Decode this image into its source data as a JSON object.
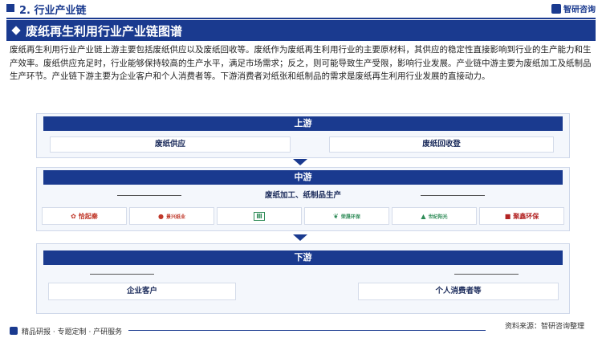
{
  "header": {
    "section": "2. 行业产业链",
    "brand": "智研咨询"
  },
  "title": "废纸再生利用行业产业链图谱",
  "description": "废纸再生利用行业产业链上游主要包括废纸供应以及废纸回收等。废纸作为废纸再生利用行业的主要原材料，其供应的稳定性直接影响到行业的生产能力和生产效率。废纸供应充足时，行业能够保持较高的生产水平，满足市场需求；反之，则可能导致生产受限，影响行业发展。产业链中游主要为废纸加工及纸制品生产环节。产业链下游主要为企业客户和个人消费者等。下游消费者对纸张和纸制品的需求是废纸再生利用行业发展的直接动力。",
  "upstream": {
    "label": "上游",
    "items": [
      "废纸供应",
      "废纸回收登"
    ]
  },
  "midstream": {
    "label": "中游",
    "sub_label": "废纸加工、纸制品生产",
    "logos": [
      {
        "text": "恰起秦",
        "color": "#c0392b",
        "icon": "seal-icon"
      },
      {
        "text": "景兴纸业",
        "color": "#c0392b",
        "icon": "brand-mark-icon"
      },
      {
        "text": "山鹰",
        "color": "#2e8b57",
        "icon": "box-logo-icon"
      },
      {
        "text": "荣晟环保",
        "color": "#2e8b57",
        "icon": "leaf-logo-icon"
      },
      {
        "text": "世纪阳光",
        "color": "#2e8b57",
        "icon": "triangle-logo-icon"
      },
      {
        "text": "聚鑫环保",
        "color": "#b22222",
        "icon": "jx-logo-icon"
      }
    ]
  },
  "downstream": {
    "label": "下游",
    "items": [
      "企业客户",
      "个人消费者等"
    ]
  },
  "footer": {
    "left": "精品研报 · 专题定制 · 产研服务",
    "right": "资料来源：智研咨询整理"
  }
}
